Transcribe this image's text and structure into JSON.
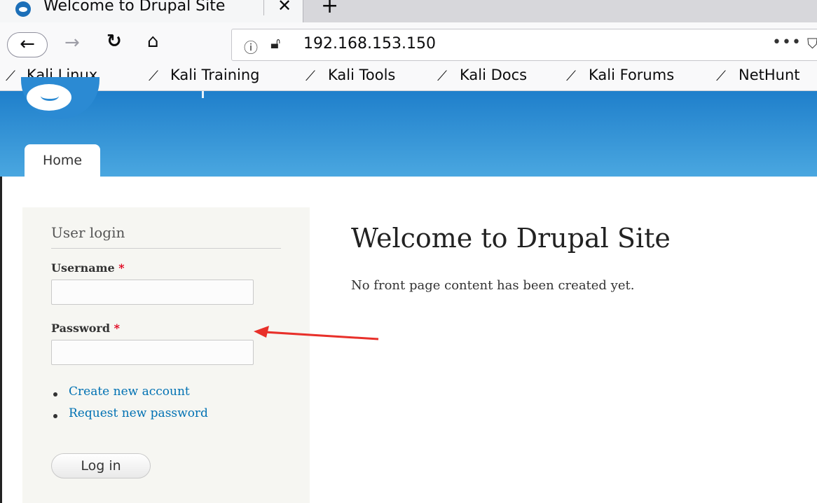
{
  "browser": {
    "tab": {
      "title": "Welcome to Drupal Site",
      "favicon": "drupal-icon",
      "close_icon": "close-icon"
    },
    "new_tab_icon": "plus-icon",
    "nav": {
      "back_icon": "arrow-left-icon",
      "forward_icon": "arrow-right-icon",
      "reload_icon": "reload-icon",
      "home_icon": "home-icon"
    },
    "url": "192.168.153.150",
    "url_info_icon": "info-icon",
    "url_insecure_icon": "insecure-lock-icon",
    "more_icon": "ellipsis-icon",
    "bookmarks": [
      {
        "label": "Kali Linux"
      },
      {
        "label": "Kali Training"
      },
      {
        "label": "Kali Tools"
      },
      {
        "label": "Kali Docs"
      },
      {
        "label": "Kali Forums"
      },
      {
        "label": "NetHunt"
      }
    ]
  },
  "site": {
    "nav_tab": "Home"
  },
  "sidebar": {
    "block_title": "User login",
    "username_label": "Username",
    "password_label": "Password",
    "required_marker": "*",
    "links": [
      "Create new account",
      "Request new password"
    ],
    "login_button": "Log in"
  },
  "main": {
    "title": "Welcome to Drupal Site",
    "body": "No front page content has been created yet."
  },
  "colors": {
    "header_top": "#1f7fcb",
    "header_bottom": "#4aa7e0",
    "link": "#0071b3",
    "required": "#e0001c",
    "annotation_arrow": "#e8302a"
  }
}
